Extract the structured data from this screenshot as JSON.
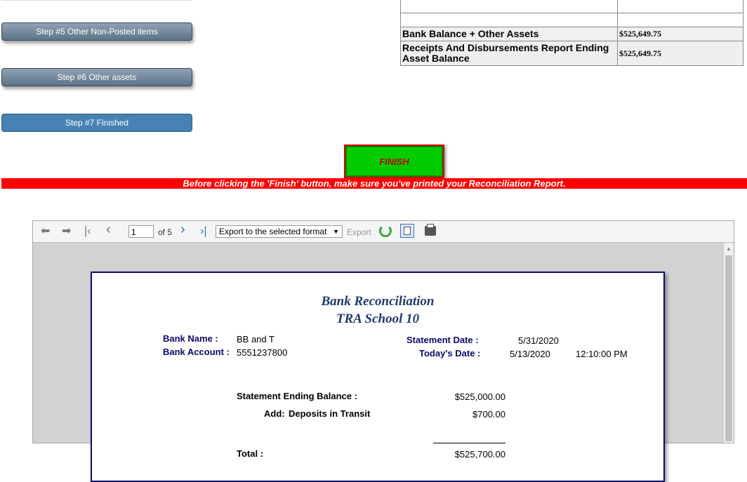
{
  "steps": {
    "step5": "Step #5 Other Non-Posted items",
    "step6": "Step #6 Other assets",
    "step7": "Step #7 Finished"
  },
  "summary": {
    "rows": [
      {
        "label": "Bank Balance + Other Assets",
        "value": "$525,649.75"
      },
      {
        "label": "Receipts And Disbursements Report Ending Asset Balance",
        "value": "$525,649.75"
      }
    ]
  },
  "finish": {
    "button_label": "FINISH",
    "warning": "Before clicking the 'Finish' button, make sure you've printed your Reconciliation Report."
  },
  "viewer": {
    "page_current": "1",
    "page_total_text": "of 5",
    "export_select": "Export to the selected format",
    "export_label": "Export",
    "icons": [
      "back-icon",
      "forward-icon",
      "first-page-icon",
      "prev-page-icon",
      "next-page-icon",
      "last-page-icon",
      "refresh-icon",
      "print-preview-icon",
      "print-icon"
    ]
  },
  "report": {
    "title": "Bank Reconciliation",
    "subtitle": "TRA School 10",
    "bank_name_label": "Bank Name :",
    "bank_name": "BB and T",
    "bank_account_label": "Bank Account :",
    "bank_account": "5551237800",
    "statement_date_label": "Statement Date :",
    "statement_date": "5/31/2020",
    "todays_date_label": "Today's Date :",
    "todays_date": "5/13/2020",
    "todays_time": "12:10:00 PM",
    "ending_balance_label": "Statement Ending Balance :",
    "ending_balance": "$525,000.00",
    "add_label": "Add:",
    "deposits_label": "Deposits in Transit",
    "deposits": "$700.00",
    "total_label": "Total :",
    "total": "$525,700.00"
  },
  "colors": {
    "finish_bg": "#00cc00",
    "warning_bg": "#ff0000",
    "report_border": "#0a0a6e",
    "step_active": "#4682b4"
  }
}
